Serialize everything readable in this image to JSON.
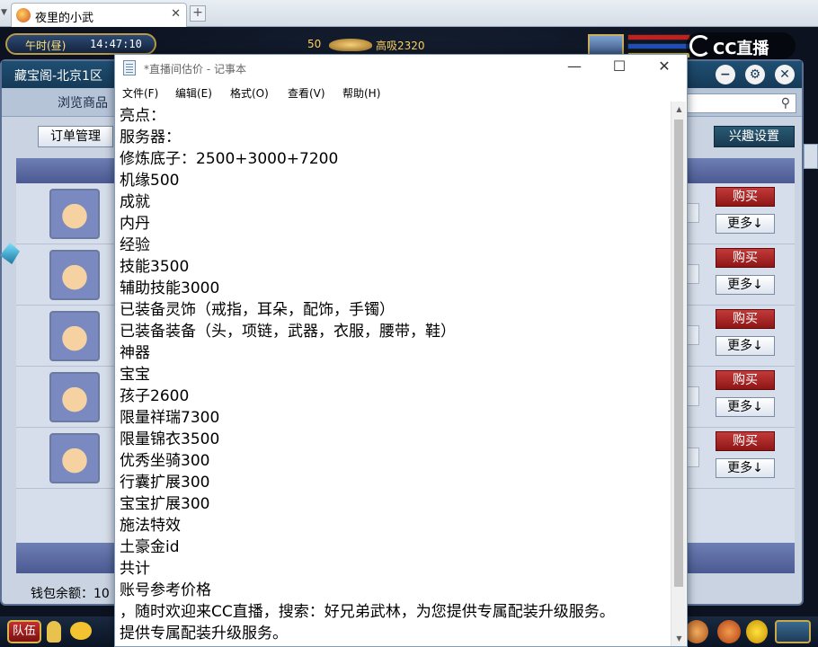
{
  "browser": {
    "tab_title": "夜里的小武",
    "tab_close": "✕",
    "new_tab": "+",
    "tab_menu_icon": "chevron-down"
  },
  "game_hud": {
    "time_label": "午时(昼)",
    "clock": "14:47:10",
    "currency_value": "50",
    "currency_status": "高吸2320",
    "stream_logo_text": "CC直播"
  },
  "shop": {
    "title": "藏宝阁-北京1区",
    "tab_browse": "浏览商品",
    "btn_orders": "订单管理",
    "btn_interest": "兴趣设置",
    "wallet_label": "钱包余额：10",
    "rows": [
      {
        "buy": "购买",
        "more": "更多↓"
      },
      {
        "buy": "购买",
        "more": "更多↓"
      },
      {
        "buy": "购买",
        "more": "更多↓"
      },
      {
        "buy": "购买",
        "more": "更多↓"
      },
      {
        "buy": "购买",
        "more": "更多↓"
      }
    ]
  },
  "bottom_hud": {
    "team_button": "队伍"
  },
  "notepad": {
    "title": "*直播间估价 - 记事本",
    "controls": {
      "minimize": "—",
      "maximize": "☐",
      "close": "✕"
    },
    "menu": [
      "文件(F)",
      "编辑(E)",
      "格式(O)",
      "查看(V)",
      "帮助(H)"
    ],
    "lines": [
      "亮点：",
      "服务器：",
      "修炼底子：2500+3000+7200",
      "机缘500",
      "成就",
      "内丹",
      "经验",
      "技能3500",
      "辅助技能3000",
      "已装备灵饰（戒指，耳朵，配饰，手镯）",
      "已装备装备（头，项链，武器，衣服，腰带，鞋）",
      "神器",
      "宝宝",
      "孩子2600",
      "限量祥瑞7300",
      "限量锦衣3500",
      "优秀坐骑300",
      "行囊扩展300",
      "宝宝扩展300",
      "施法特效",
      "土豪金id",
      "共计",
      "账号参考价格",
      "，随时欢迎来CC直播，搜索：好兄弟武林，为您提供专属配装升级服务。",
      "提供专属配装升级服务。"
    ]
  }
}
